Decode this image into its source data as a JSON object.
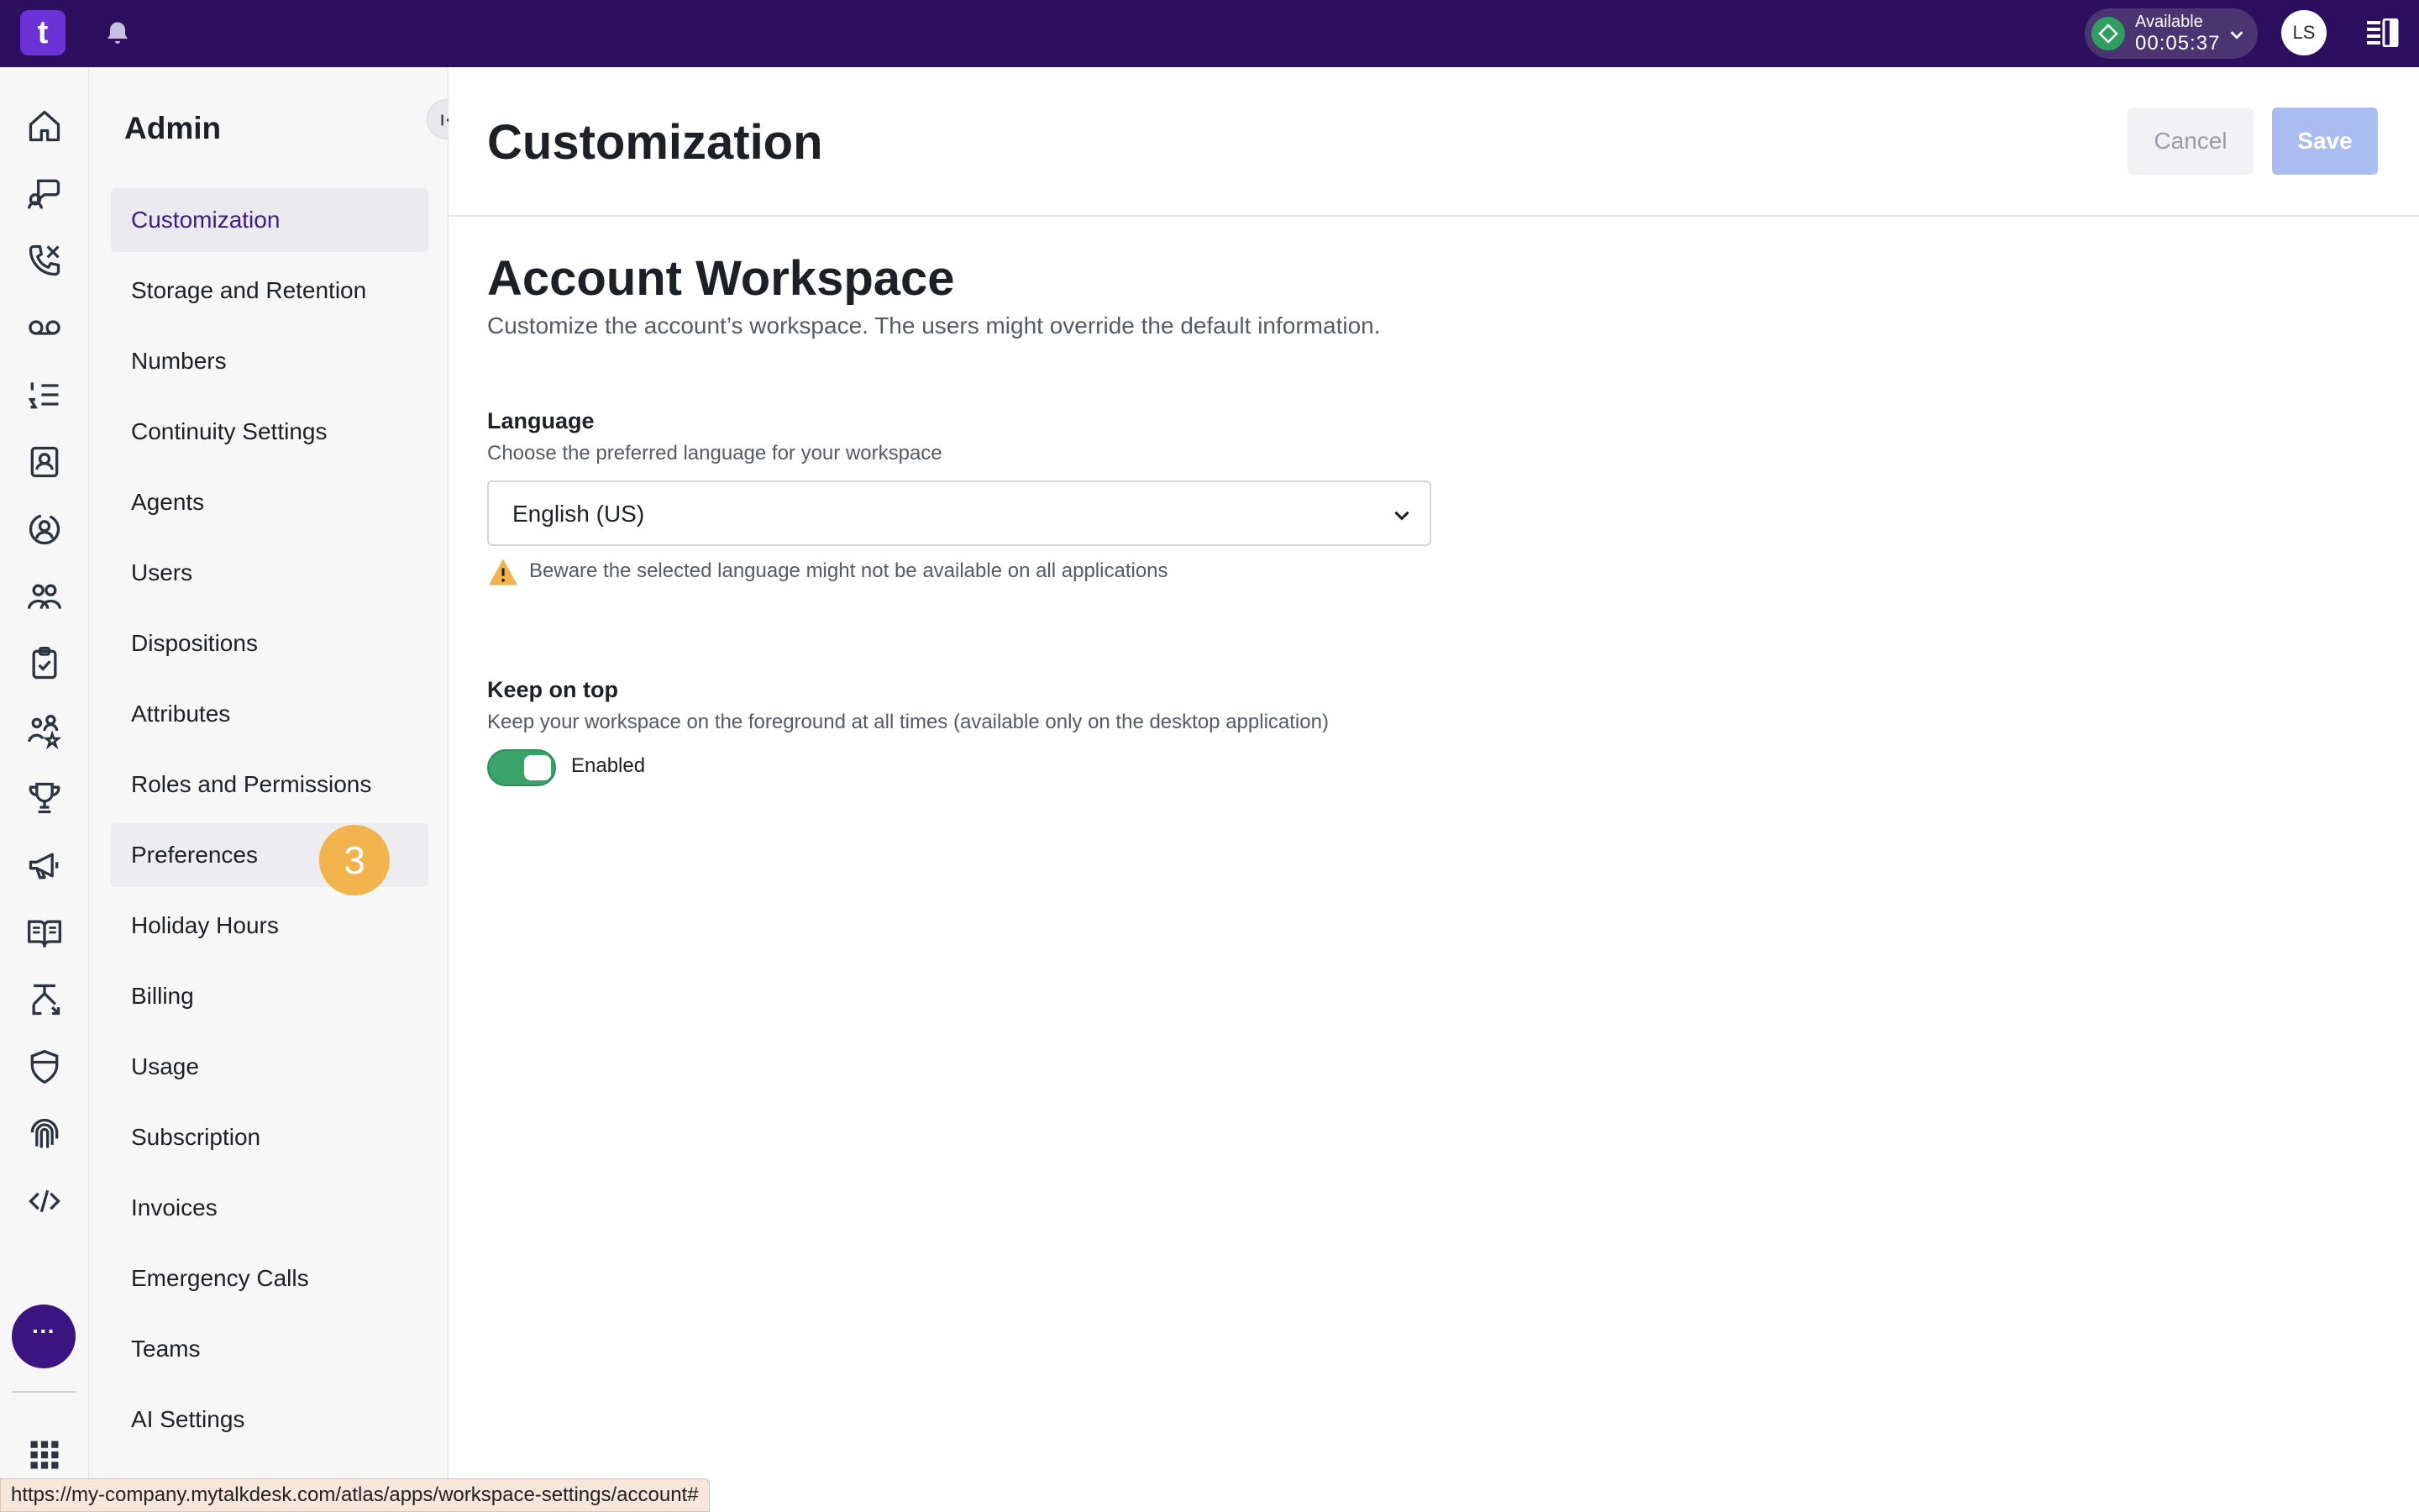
{
  "app": {
    "logo_text": "t"
  },
  "topbar": {
    "status_label": "Available",
    "status_timer": "00:05:37",
    "avatar_initials": "LS"
  },
  "rail": {
    "icons": [
      "home-icon",
      "chat-icon",
      "phone-icon",
      "voicemail-icon",
      "list-icon",
      "contacts-icon",
      "agent-icon",
      "team-icon",
      "clipboard-icon",
      "people-star-icon",
      "trophy-icon",
      "megaphone-icon",
      "book-icon",
      "routing-icon",
      "shield-icon",
      "fingerprint-icon",
      "code-icon"
    ],
    "more_label": "···"
  },
  "sidebar": {
    "title": "Admin",
    "items": [
      {
        "label": "Customization"
      },
      {
        "label": "Storage and Retention"
      },
      {
        "label": "Numbers"
      },
      {
        "label": "Continuity Settings"
      },
      {
        "label": "Agents"
      },
      {
        "label": "Users"
      },
      {
        "label": "Dispositions"
      },
      {
        "label": "Attributes"
      },
      {
        "label": "Roles and Permissions"
      },
      {
        "label": "Preferences"
      },
      {
        "label": "Holiday Hours"
      },
      {
        "label": "Billing"
      },
      {
        "label": "Usage"
      },
      {
        "label": "Subscription"
      },
      {
        "label": "Invoices"
      },
      {
        "label": "Emergency Calls"
      },
      {
        "label": "Teams"
      },
      {
        "label": "AI Settings"
      }
    ],
    "step_badge": "3"
  },
  "main": {
    "title": "Customization",
    "cancel_label": "Cancel",
    "save_label": "Save",
    "section": {
      "title": "Account Workspace",
      "description": "Customize the account’s workspace. The users might override the default information."
    },
    "language": {
      "label": "Language",
      "help": "Choose the preferred language for your workspace",
      "value": "English (US)",
      "warning": "Beware the selected language might not be available on all applications"
    },
    "keep_on_top": {
      "label": "Keep on top",
      "help": "Keep your workspace on the foreground at all times (available only on the desktop application)",
      "toggle_label": "Enabled",
      "enabled": true
    }
  },
  "statusbar": {
    "url": "https://my-company.mytalkdesk.com/atlas/apps/workspace-settings/account#"
  },
  "colors": {
    "topbar": "#2c0f5e",
    "accent": "#6b33d6",
    "active_nav_text": "#3b1d8a",
    "save_disabled": "#a9bdf0",
    "toggle_on": "#3aa36a",
    "badge": "#f2b24c"
  }
}
